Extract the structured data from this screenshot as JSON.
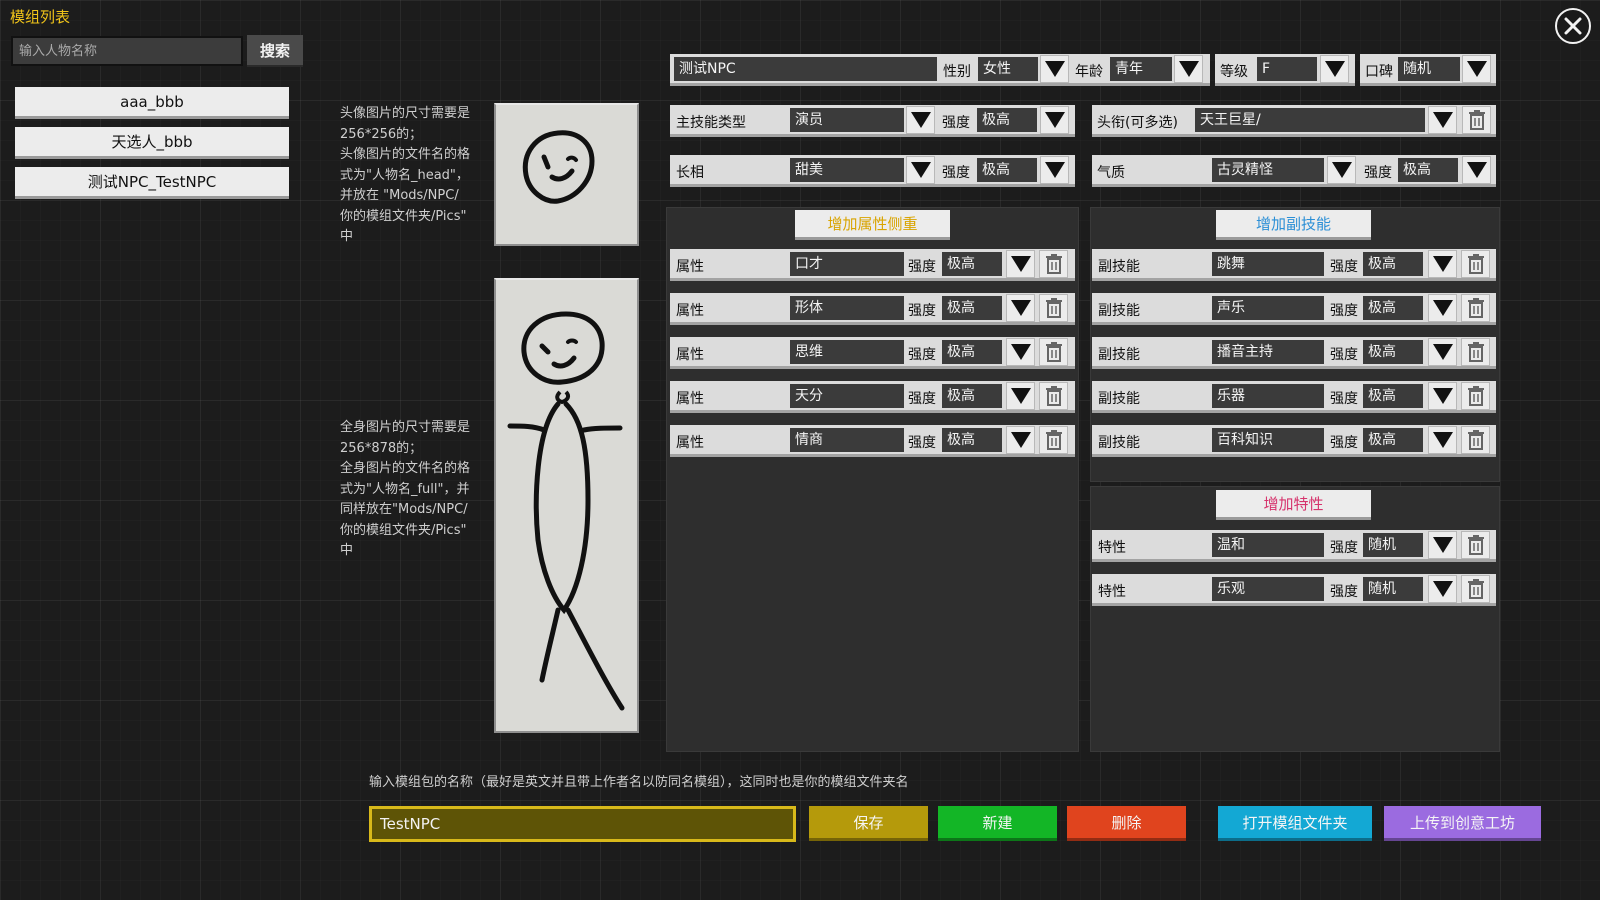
{
  "left_panel": {
    "title": "模组列表",
    "search": {
      "placeholder": "输入人物名称",
      "value": "",
      "button": "搜索"
    },
    "mods": [
      "aaa_bbb",
      "天选人_bbb",
      "测试NPC_TestNPC"
    ]
  },
  "notes": {
    "head": "头像图片的尺寸需要是\n256*256的；\n头像图片的文件名的格\n式为\"人物名_head\"，\n并放在 \"Mods/NPC/\n你的模组文件夹/Pics\"\n中",
    "full": "全身图片的尺寸需要是\n256*878的；\n全身图片的文件名的格\n式为\"人物名_full\"，并\n同样放在\"Mods/NPC/\n你的模组文件夹/Pics\"\n中"
  },
  "header": {
    "name": "测试NPC",
    "gender_label": "性别",
    "gender": "女性",
    "age_label": "年龄",
    "age": "青年",
    "level_label": "等级",
    "level": "F",
    "reputation_label": "口碑",
    "reputation": "随机"
  },
  "main_skill": {
    "label": "主技能类型",
    "value": "演员",
    "strength_label": "强度",
    "strength": "极高"
  },
  "title_row": {
    "label": "头衔(可多选)",
    "value": "天王巨星/"
  },
  "appearance": {
    "label": "长相",
    "value": "甜美",
    "strength_label": "强度",
    "strength": "极高"
  },
  "temperament": {
    "label": "气质",
    "value": "古灵精怪",
    "strength_label": "强度",
    "strength": "极高"
  },
  "attributes": {
    "add_button": "增加属性侧重",
    "rows": [
      {
        "label": "属性",
        "value": "口才",
        "strength_label": "强度",
        "strength": "极高"
      },
      {
        "label": "属性",
        "value": "形体",
        "strength_label": "强度",
        "strength": "极高"
      },
      {
        "label": "属性",
        "value": "思维",
        "strength_label": "强度",
        "strength": "极高"
      },
      {
        "label": "属性",
        "value": "天分",
        "strength_label": "强度",
        "strength": "极高"
      },
      {
        "label": "属性",
        "value": "情商",
        "strength_label": "强度",
        "strength": "极高"
      }
    ]
  },
  "sub_skills": {
    "add_button": "增加副技能",
    "rows": [
      {
        "label": "副技能",
        "value": "跳舞",
        "strength_label": "强度",
        "strength": "极高"
      },
      {
        "label": "副技能",
        "value": "声乐",
        "strength_label": "强度",
        "strength": "极高"
      },
      {
        "label": "副技能",
        "value": "播音主持",
        "strength_label": "强度",
        "strength": "极高"
      },
      {
        "label": "副技能",
        "value": "乐器",
        "strength_label": "强度",
        "strength": "极高"
      },
      {
        "label": "副技能",
        "value": "百科知识",
        "strength_label": "强度",
        "strength": "极高"
      }
    ]
  },
  "traits": {
    "add_button": "增加特性",
    "rows": [
      {
        "label": "特性",
        "value": "温和",
        "strength_label": "强度",
        "strength": "随机"
      },
      {
        "label": "特性",
        "value": "乐观",
        "strength_label": "强度",
        "strength": "随机"
      }
    ]
  },
  "bottom": {
    "hint": "输入模组包的名称（最好是英文并且带上作者名以防同名模组），这同时也是你的模组文件夹名",
    "pack_name": "TestNPC",
    "save": "保存",
    "new": "新建",
    "delete": "删除",
    "open_folder": "打开模组文件夹",
    "upload": "上传到创意工坊"
  },
  "colors": {
    "accent_yellow": "#f0c419",
    "attr_button_text": "#d9a400",
    "subskill_button_text": "#2b8fd6",
    "trait_button_text": "#d6336c",
    "save": "#b59a0b",
    "new": "#13b626",
    "delete": "#e0441e",
    "open_folder": "#13a8d4",
    "upload": "#9b6be0"
  },
  "icons": {
    "dropdown": "triangle-down-icon",
    "delete": "trash-icon",
    "close": "close-circle-icon"
  }
}
